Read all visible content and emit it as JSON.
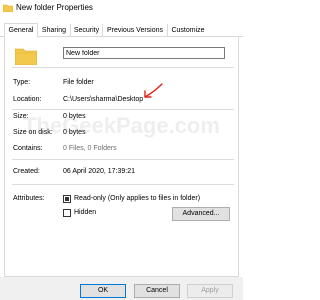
{
  "window": {
    "title": "New folder Properties"
  },
  "tabs": [
    {
      "label": "General",
      "active": true
    },
    {
      "label": "Sharing",
      "active": false
    },
    {
      "label": "Security",
      "active": false
    },
    {
      "label": "Previous Versions",
      "active": false
    },
    {
      "label": "Customize",
      "active": false
    }
  ],
  "general": {
    "folder_name_value": "New folder",
    "rows": {
      "type": {
        "label": "Type:",
        "value": "File folder"
      },
      "location": {
        "label": "Location:",
        "value": "C:\\Users\\sharma\\Desktop"
      },
      "size": {
        "label": "Size:",
        "value": "0 bytes"
      },
      "size_on_disk": {
        "label": "Size on disk:",
        "value": "0 bytes"
      },
      "contains": {
        "label": "Contains:",
        "value": "0 Files, 0 Folders"
      },
      "created": {
        "label": "Created:",
        "value": "06 April 2020, 17:39:21"
      }
    },
    "attributes": {
      "label": "Attributes:",
      "readonly": {
        "label": "Read-only (Only applies to files in folder)",
        "state": "indeterminate"
      },
      "hidden": {
        "label": "Hidden",
        "state": "unchecked"
      },
      "advanced_label": "Advanced..."
    }
  },
  "watermark": "TheGeekPage.com",
  "footer": {
    "ok_label": "OK",
    "cancel_label": "Cancel",
    "apply_label": "Apply"
  },
  "colors": {
    "accent": "#0078d7",
    "annotation_arrow": "#e0231b",
    "folder_yellow": "#f2c94c"
  }
}
